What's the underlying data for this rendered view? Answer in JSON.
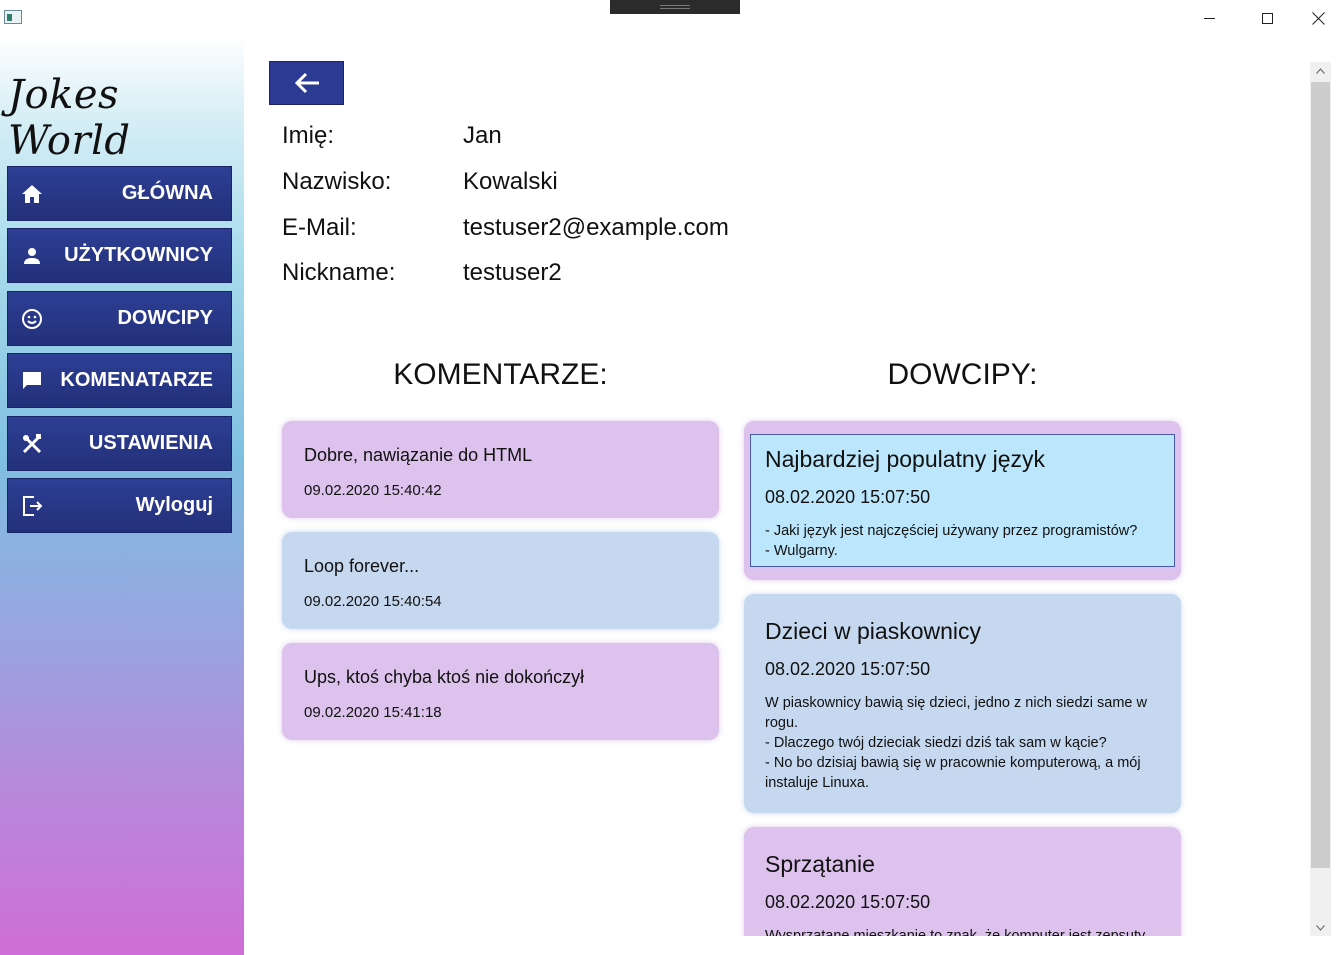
{
  "window": {
    "icon": "app-window-icon"
  },
  "sidebar": {
    "brand": "Jokes World",
    "items": [
      {
        "label": "GŁÓWNA",
        "icon": "home-icon"
      },
      {
        "label": "UŻYTKOWNICY",
        "icon": "person-icon"
      },
      {
        "label": "DOWCIPY",
        "icon": "smiley-icon"
      },
      {
        "label": "KOMENATARZE",
        "icon": "comment-icon"
      },
      {
        "label": "USTAWIENIA",
        "icon": "tools-icon"
      },
      {
        "label": "Wyloguj",
        "icon": "logout-icon"
      }
    ]
  },
  "user": {
    "first_name_label": "Imię:",
    "first_name": "Jan",
    "last_name_label": "Nazwisko:",
    "last_name": "Kowalski",
    "email_label": "E-Mail:",
    "email": "testuser2@example.com",
    "nickname_label": "Nickname:",
    "nickname": "testuser2"
  },
  "comments": {
    "title": "KOMENTARZE:",
    "items": [
      {
        "text": "Dobre, nawiązanie do HTML",
        "date": "09.02.2020 15:40:42"
      },
      {
        "text": "Loop forever...",
        "date": "09.02.2020 15:40:54"
      },
      {
        "text": "Ups, ktoś chyba ktoś nie dokończył",
        "date": "09.02.2020 15:41:18"
      }
    ]
  },
  "jokes": {
    "title": "DOWCIPY:",
    "items": [
      {
        "title": "Najbardziej populatny język",
        "date": "08.02.2020 15:07:50",
        "body": "- Jaki język jest najczęściej używany przez programistów?\n- Wulgarny."
      },
      {
        "title": "Dzieci w piaskownicy",
        "date": "08.02.2020 15:07:50",
        "body": "W piaskownicy bawią się dzieci, jedno z nich siedzi same w rogu.\n- Dlaczego twój dzieciak siedzi dziś tak sam w kącie?\n- No bo dzisiaj bawią się w pracownie komputerową, a mój instaluje Linuxa."
      },
      {
        "title": "Sprzątanie",
        "date": "08.02.2020 15:07:50",
        "body": "Wysprzątane mieszkanie to znak, że komputer jest zepsuty."
      }
    ]
  },
  "colors": {
    "nav": "#2d3e94",
    "card_pink": "#dcc2ec",
    "card_blue": "#c5d8ef",
    "selected": "#bbe6fb"
  }
}
